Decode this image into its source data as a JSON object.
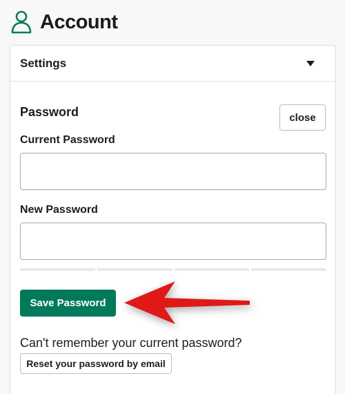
{
  "header": {
    "title": "Account",
    "icon": "user-icon"
  },
  "settings": {
    "label": "Settings",
    "icon": "caret-down-icon"
  },
  "password": {
    "section_title": "Password",
    "close_label": "close",
    "current_label": "Current Password",
    "current_value": "",
    "new_label": "New Password",
    "new_value": "",
    "save_label": "Save Password",
    "forgot_text": "Can't remember your current password?",
    "reset_label": "Reset your password by email"
  },
  "colors": {
    "accent": "#007a5a",
    "arrow": "#e01818",
    "icon": "#0e7a5c"
  }
}
